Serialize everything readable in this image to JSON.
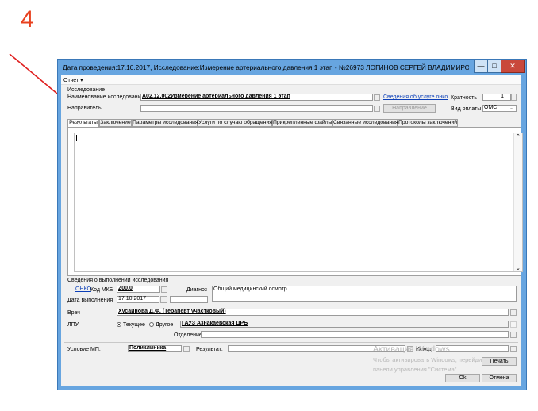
{
  "slide_number": "4",
  "window": {
    "title": "Дата проведения:17.10.2017, Исследование:Измерение артериального давления 1 этап - №26973 ЛОГИНОВ СЕРГЕЙ ВЛАДИМИРО...",
    "minimize_glyph": "—",
    "maximize_glyph": "□",
    "close_glyph": "✕"
  },
  "menu": {
    "report": "Отчет ▾"
  },
  "study": {
    "group_label": "Исследование",
    "name_label": "Наименование исследования",
    "name_value": "А02.12.002Измерение артериального давления 1 этап",
    "onco_link": "Сведения об услуге онко",
    "multiplicity_label": "Кратность",
    "multiplicity_value": "1",
    "referrer_label": "Направитель",
    "referral_button": "Направление",
    "payment_label": "Вид оплаты",
    "payment_value": "ОМС"
  },
  "tabs": [
    "Результаты",
    "Заключение",
    "Параметры исследования",
    "Услуги по случаю обращения",
    "Прикрепленные файлы",
    "Связанные исследования",
    "Протоколы заключений"
  ],
  "execution": {
    "group_label": "Сведения о выполнении исследования",
    "onko_link": "ОНКО",
    "mkb_label": "Код МКБ",
    "mkb_value": "Z00.0",
    "diagnosis_label": "Диагноз",
    "diagnosis_value": "Общий медицинский осмотр",
    "date_label": "Дата выполнения",
    "date_value": "17.10.2017",
    "doctor_label": "Врач",
    "doctor_value": "Хусаинова Д.Ф. (Терапевт участковый)",
    "lpu_label": "ЛПУ",
    "radio_current": "Текущее",
    "radio_other": "Другое",
    "lpu_value": "ГАУЗ Азнакаевская ЦРБ",
    "department_label": "Отделение"
  },
  "footer": {
    "condition_label": "Условие МП:",
    "condition_value": "Поликлиника",
    "result_label": "Результат:",
    "outcome_label": "Исход:",
    "print_button": "Печать",
    "ok_button": "Ok",
    "cancel_button": "Отмена"
  },
  "watermark": {
    "line1": "Активация Windows",
    "line2": "Чтобы активировать Windows, перейдите",
    "line3": "панели управления \"Система\"."
  }
}
